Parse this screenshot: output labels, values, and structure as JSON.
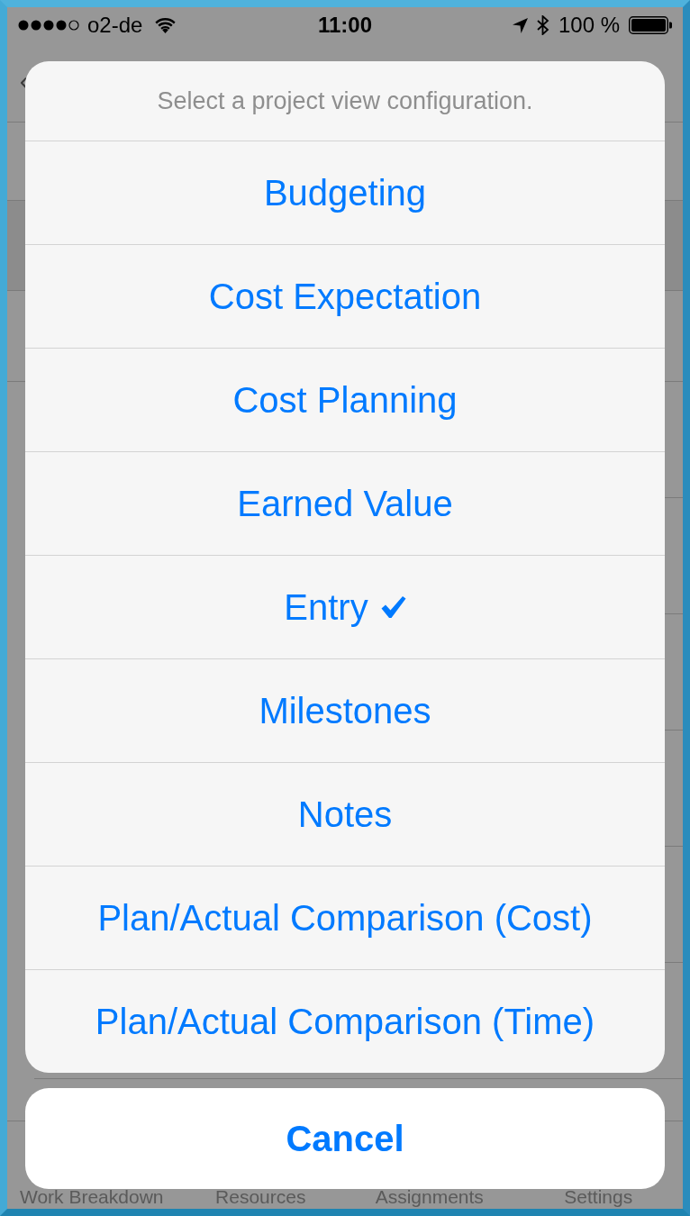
{
  "status_bar": {
    "carrier": "o2-de",
    "time": "11:00",
    "battery": "100 %"
  },
  "action_sheet": {
    "title": "Select a project view configuration.",
    "options": [
      {
        "label": "Budgeting",
        "selected": false
      },
      {
        "label": "Cost Expectation",
        "selected": false
      },
      {
        "label": "Cost Planning",
        "selected": false
      },
      {
        "label": "Earned Value",
        "selected": false
      },
      {
        "label": "Entry",
        "selected": true
      },
      {
        "label": "Milestones",
        "selected": false
      },
      {
        "label": "Notes",
        "selected": false
      },
      {
        "label": "Plan/Actual Comparison (Cost)",
        "selected": false
      },
      {
        "label": "Plan/Actual Comparison (Time)",
        "selected": false
      }
    ],
    "cancel": "Cancel"
  },
  "tab_bar": {
    "items": [
      {
        "label": "Work Breakdown"
      },
      {
        "label": "Resources"
      },
      {
        "label": "Assignments"
      },
      {
        "label": "Settings"
      }
    ]
  }
}
